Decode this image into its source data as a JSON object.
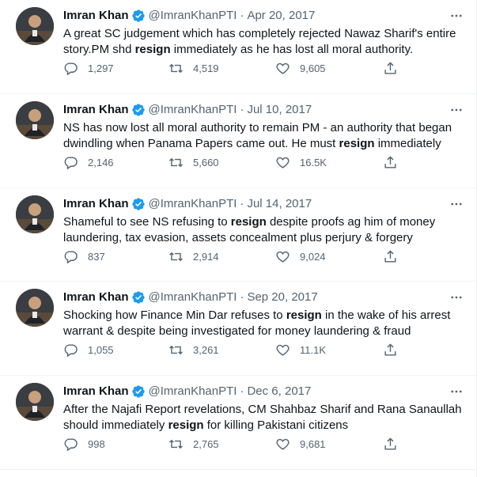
{
  "colors": {
    "text": "#0f1419",
    "secondary": "#536471",
    "verified": "#1d9bf0",
    "border": "#eff3f4"
  },
  "tweets": [
    {
      "name": "Imran Khan",
      "handle": "@ImranKhanPTI",
      "sep": "·",
      "date": "Apr 20, 2017",
      "text": [
        {
          "t": "A great SC judgement which has completely rejected Nawaz Sharif's entire story.PM shd ",
          "b": false
        },
        {
          "t": "resign",
          "b": true
        },
        {
          "t": " immediately as he has lost all moral authority.",
          "b": false
        }
      ],
      "replies": "1,297",
      "retweets": "4,519",
      "likes": "9,605"
    },
    {
      "name": "Imran Khan",
      "handle": "@ImranKhanPTI",
      "sep": "·",
      "date": "Jul 10, 2017",
      "text": [
        {
          "t": "NS has now lost all moral authority to remain PM - an authority that began dwindling when Panama Papers came out. He must ",
          "b": false
        },
        {
          "t": "resign",
          "b": true
        },
        {
          "t": " immediately",
          "b": false
        }
      ],
      "replies": "2,146",
      "retweets": "5,660",
      "likes": "16.5K"
    },
    {
      "name": "Imran Khan",
      "handle": "@ImranKhanPTI",
      "sep": "·",
      "date": "Jul 14, 2017",
      "text": [
        {
          "t": "Shameful to see NS refusing to ",
          "b": false
        },
        {
          "t": "resign",
          "b": true
        },
        {
          "t": " despite proofs ag him of money laundering, tax evasion, assets concealment plus perjury & forgery",
          "b": false
        }
      ],
      "replies": "837",
      "retweets": "2,914",
      "likes": "9,024"
    },
    {
      "name": "Imran Khan",
      "handle": "@ImranKhanPTI",
      "sep": "·",
      "date": "Sep 20, 2017",
      "text": [
        {
          "t": "Shocking how Finance Min Dar refuses to ",
          "b": false
        },
        {
          "t": "resign",
          "b": true
        },
        {
          "t": " in the wake of his arrest warrant & despite being investigated for money laundering & fraud",
          "b": false
        }
      ],
      "replies": "1,055",
      "retweets": "3,261",
      "likes": "11.1K"
    },
    {
      "name": "Imran Khan",
      "handle": "@ImranKhanPTI",
      "sep": "·",
      "date": "Dec 6, 2017",
      "text": [
        {
          "t": "After the Najafi Report revelations, CM Shahbaz Sharif and Rana Sanaullah should immediately ",
          "b": false
        },
        {
          "t": "resign",
          "b": true
        },
        {
          "t": " for killing Pakistani citizens",
          "b": false
        }
      ],
      "replies": "998",
      "retweets": "2,765",
      "likes": "9,681"
    }
  ]
}
